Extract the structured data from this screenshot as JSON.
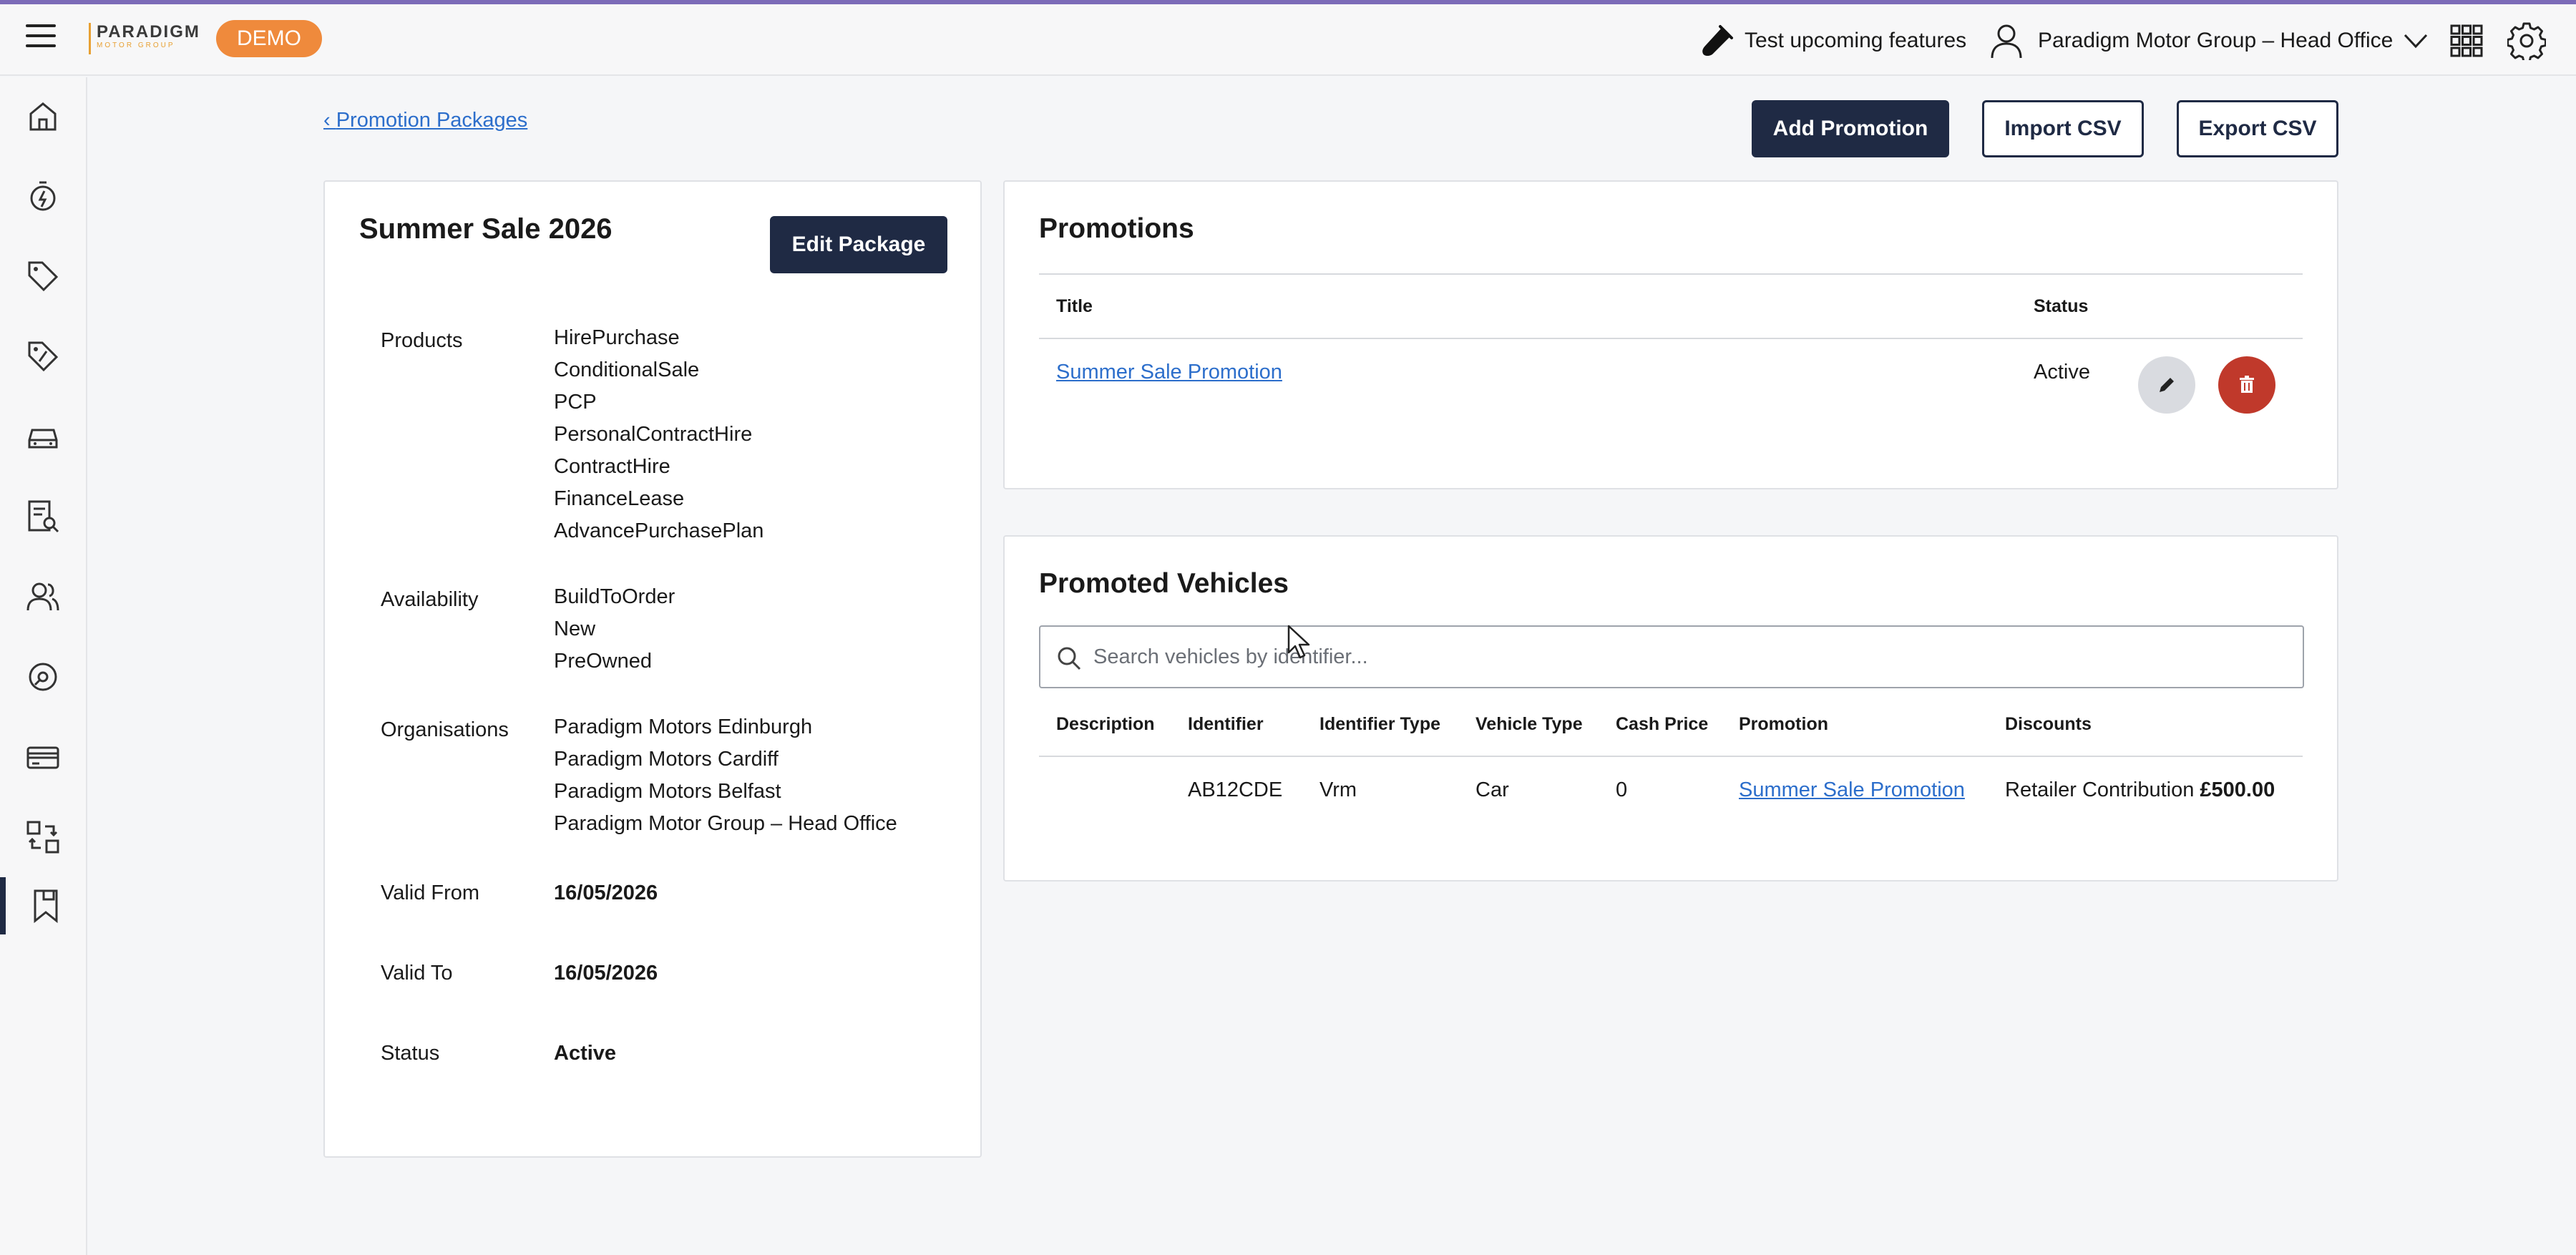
{
  "header": {
    "logo_text": "PARADIGM",
    "logo_sub": "MOTOR GROUP",
    "demo_badge": "DEMO",
    "test_features_label": "Test upcoming features",
    "org_name": "Paradigm Motor Group – Head Office"
  },
  "sidebar": {
    "items": [
      {
        "icon": "home-icon"
      },
      {
        "icon": "stopwatch-icon"
      },
      {
        "icon": "tag-icon"
      },
      {
        "icon": "pricing-tag-icon"
      },
      {
        "icon": "car-icon"
      },
      {
        "icon": "report-search-icon"
      },
      {
        "icon": "users-icon"
      },
      {
        "icon": "settings-badge-icon"
      },
      {
        "icon": "payment-card-icon"
      },
      {
        "icon": "transfer-icon"
      },
      {
        "icon": "bookmark-icon"
      }
    ],
    "active_index": 10
  },
  "breadcrumb": {
    "back_label": "Promotion Packages"
  },
  "toolbar": {
    "add_promotion": "Add Promotion",
    "import_csv": "Import CSV",
    "export_csv": "Export CSV"
  },
  "package": {
    "title": "Summer Sale 2026",
    "edit_button": "Edit Package",
    "products_label": "Products",
    "products": [
      "HirePurchase",
      "ConditionalSale",
      "PCP",
      "PersonalContractHire",
      "ContractHire",
      "FinanceLease",
      "AdvancePurchasePlan"
    ],
    "availability_label": "Availability",
    "availability": [
      "BuildToOrder",
      "New",
      "PreOwned"
    ],
    "organisations_label": "Organisations",
    "organisations": [
      "Paradigm Motors Edinburgh",
      "Paradigm Motors Cardiff",
      "Paradigm Motors Belfast",
      "Paradigm Motor Group – Head Office"
    ],
    "valid_from_label": "Valid From",
    "valid_from": "16/05/2026",
    "valid_to_label": "Valid To",
    "valid_to": "16/05/2026",
    "status_label": "Status",
    "status": "Active"
  },
  "promotions": {
    "title": "Promotions",
    "columns": {
      "title": "Title",
      "status": "Status"
    },
    "rows": [
      {
        "title": "Summer Sale Promotion",
        "status": "Active"
      }
    ]
  },
  "promoted_vehicles": {
    "title": "Promoted Vehicles",
    "search_placeholder": "Search vehicles by identifier...",
    "columns": {
      "description": "Description",
      "identifier": "Identifier",
      "identifier_type": "Identifier Type",
      "vehicle_type": "Vehicle Type",
      "cash_price": "Cash Price",
      "promotion": "Promotion",
      "discounts": "Discounts"
    },
    "rows": [
      {
        "description": "",
        "identifier": "AB12CDE",
        "identifier_type": "Vrm",
        "vehicle_type": "Car",
        "cash_price": "0",
        "promotion": "Summer Sale Promotion",
        "discount_name": "Retailer Contribution",
        "discount_amount": "£500.00"
      }
    ]
  },
  "colors": {
    "primary_dark": "#1f2a44",
    "demo_orange": "#ef8a3c",
    "link_blue": "#2c6ecb",
    "delete_red": "#c0392b"
  }
}
